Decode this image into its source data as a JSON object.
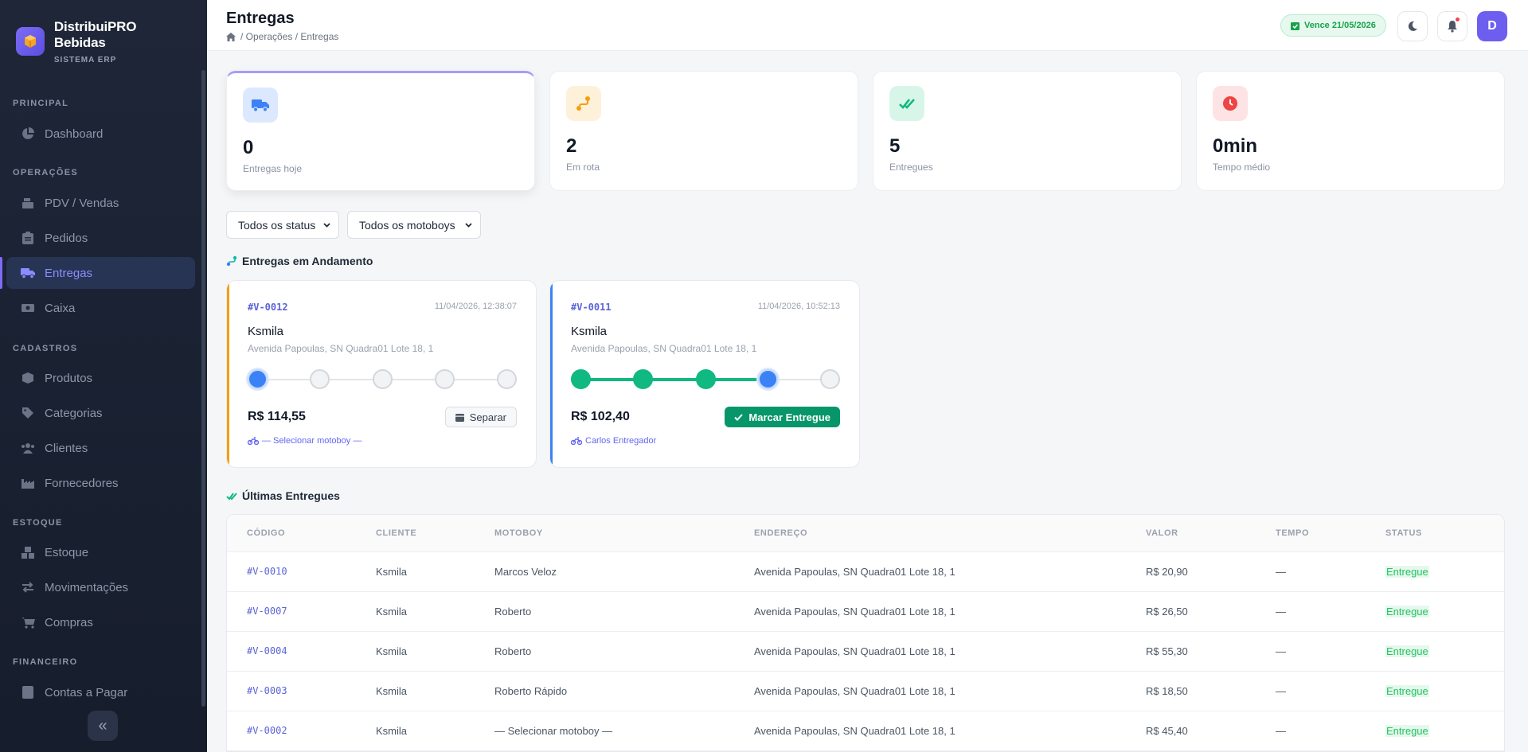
{
  "brand": {
    "name": "DistribuiPRO Bebidas",
    "subtitle": "SISTEMA ERP"
  },
  "sidebar": {
    "sections": [
      {
        "label": "PRINCIPAL"
      },
      {
        "label": "OPERAÇÕES"
      },
      {
        "label": "CADASTROS"
      },
      {
        "label": "ESTOQUE"
      },
      {
        "label": "FINANCEIRO"
      }
    ],
    "items": [
      {
        "label": "Dashboard",
        "icon": "chart-pie-icon"
      },
      {
        "label": "PDV / Vendas",
        "icon": "cash-register-icon"
      },
      {
        "label": "Pedidos",
        "icon": "clipboard-icon"
      },
      {
        "label": "Entregas",
        "icon": "truck-icon",
        "active": true
      },
      {
        "label": "Caixa",
        "icon": "money-icon"
      },
      {
        "label": "Produtos",
        "icon": "box-icon"
      },
      {
        "label": "Categorias",
        "icon": "tags-icon"
      },
      {
        "label": "Clientes",
        "icon": "users-icon"
      },
      {
        "label": "Fornecedores",
        "icon": "industry-icon"
      },
      {
        "label": "Estoque",
        "icon": "boxes-icon"
      },
      {
        "label": "Movimentações",
        "icon": "exchange-icon"
      },
      {
        "label": "Compras",
        "icon": "cart-icon"
      },
      {
        "label": "Contas a Pagar",
        "icon": "invoice-icon"
      }
    ],
    "collapse_glyph": "«"
  },
  "header": {
    "title": "Entregas",
    "breadcrumb": "/ Operações / Entregas",
    "expiry": "Vence 21/05/2026",
    "avatar_initial": "D"
  },
  "stats": [
    {
      "value": "0",
      "label": "Entregas hoje",
      "icon": "truck-icon",
      "color": "#3b82f6"
    },
    {
      "value": "2",
      "label": "Em rota",
      "icon": "route-icon",
      "color": "#f59e0b"
    },
    {
      "value": "5",
      "label": "Entregues",
      "icon": "check-double-icon",
      "color": "#10b981"
    },
    {
      "value": "0min",
      "label": "Tempo médio",
      "icon": "clock-icon",
      "color": "#ef4444"
    }
  ],
  "filters": {
    "status": "Todos os status",
    "motoboy": "Todos os motoboys"
  },
  "in_progress": {
    "title": "Entregas em Andamento",
    "cards": [
      {
        "code": "#V-0012",
        "date": "11/04/2026, 12:38:07",
        "client": "Ksmila",
        "address": "Avenida Papoulas, SN Quadra01 Lote 18, 1",
        "price": "R$ 114,55",
        "motoboy": "— Selecionar motoboy —",
        "action": "Separar",
        "step": 1,
        "steps_total": 5,
        "accent": "#f59e0b"
      },
      {
        "code": "#V-0011",
        "date": "11/04/2026, 10:52:13",
        "client": "Ksmila",
        "address": "Avenida Papoulas, SN Quadra01 Lote 18, 1",
        "price": "R$ 102,40",
        "motoboy": "Carlos Entregador",
        "action": "Marcar Entregue",
        "step": 4,
        "steps_total": 5,
        "accent": "#3b82f6"
      }
    ]
  },
  "delivered": {
    "title": "Últimas Entregues",
    "columns": [
      "CÓDIGO",
      "CLIENTE",
      "MOTOBOY",
      "ENDEREÇO",
      "VALOR",
      "TEMPO",
      "STATUS"
    ],
    "rows": [
      {
        "code": "#V-0010",
        "client": "Ksmila",
        "motoboy": "Marcos Veloz",
        "address": "Avenida Papoulas, SN Quadra01 Lote 18, 1",
        "value": "R$ 20,90",
        "time": "—",
        "status": "Entregue"
      },
      {
        "code": "#V-0007",
        "client": "Ksmila",
        "motoboy": "Roberto",
        "address": "Avenida Papoulas, SN Quadra01 Lote 18, 1",
        "value": "R$ 26,50",
        "time": "—",
        "status": "Entregue"
      },
      {
        "code": "#V-0004",
        "client": "Ksmila",
        "motoboy": "Roberto",
        "address": "Avenida Papoulas, SN Quadra01 Lote 18, 1",
        "value": "R$ 55,30",
        "time": "—",
        "status": "Entregue"
      },
      {
        "code": "#V-0003",
        "client": "Ksmila",
        "motoboy": "Roberto Rápido",
        "address": "Avenida Papoulas, SN Quadra01 Lote 18, 1",
        "value": "R$ 18,50",
        "time": "—",
        "status": "Entregue"
      },
      {
        "code": "#V-0002",
        "client": "Ksmila",
        "motoboy": "— Selecionar motoboy —",
        "address": "Avenida Papoulas, SN Quadra01 Lote 18, 1",
        "value": "R$ 45,40",
        "time": "—",
        "status": "Entregue"
      }
    ]
  }
}
